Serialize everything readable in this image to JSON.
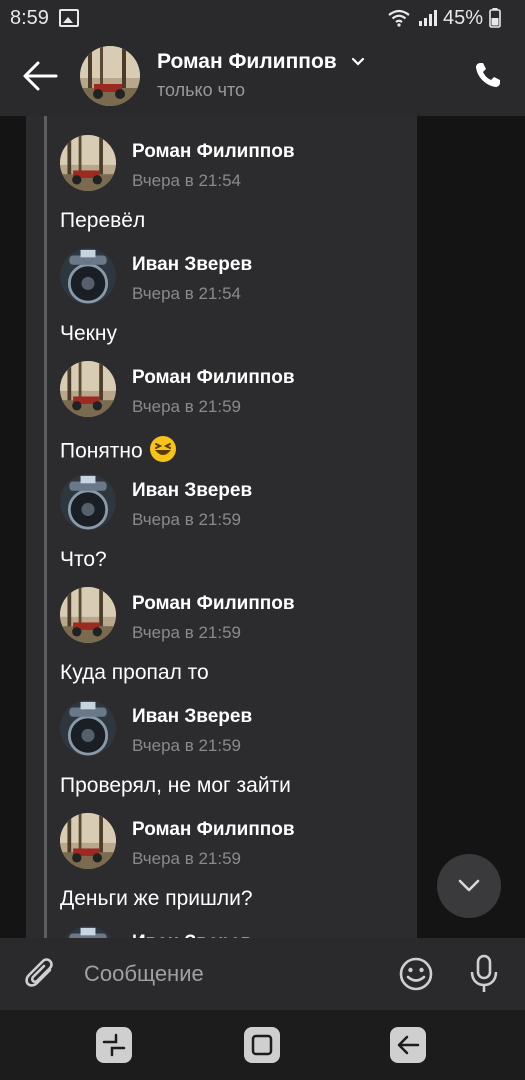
{
  "status_bar": {
    "time": "8:59",
    "battery": "45%"
  },
  "header": {
    "contact_name": "Роман Филиппов",
    "status": "только что"
  },
  "messages": [
    {
      "author": "Роман Филиппов",
      "time": "Вчера в 21:54",
      "text": "Перевёл",
      "avatar": "moto"
    },
    {
      "author": "Иван Зверев",
      "time": "Вчера в 21:54",
      "text": "Чекну",
      "avatar": "car"
    },
    {
      "author": "Роман Филиппов",
      "time": "Вчера в 21:59",
      "text": "Понятно",
      "avatar": "moto",
      "emoji": "laughing-face"
    },
    {
      "author": "Иван Зверев",
      "time": "Вчера в 21:59",
      "text": "Что?",
      "avatar": "car"
    },
    {
      "author": "Роман Филиппов",
      "time": "Вчера в 21:59",
      "text": "Куда пропал то",
      "avatar": "moto"
    },
    {
      "author": "Иван Зверев",
      "time": "Вчера в 21:59",
      "text": "Проверял, не мог зайти",
      "avatar": "car"
    },
    {
      "author": "Роман Филиппов",
      "time": "Вчера в 21:59",
      "text": "Деньги же пришли?",
      "avatar": "moto"
    },
    {
      "author": "Иван Зверев",
      "time": "",
      "text": "",
      "avatar": "car"
    }
  ],
  "composer": {
    "placeholder": "Сообщение"
  },
  "icons": {
    "back": "arrow-left-icon",
    "call": "phone-icon",
    "attach": "paperclip-icon",
    "smile": "smiley-icon",
    "mic": "microphone-icon",
    "scroll": "chevron-down-icon"
  },
  "colors": {
    "header_bg": "#2a2a2c",
    "chat_bg": "#2c2c2e",
    "screen_bg": "#141414"
  }
}
